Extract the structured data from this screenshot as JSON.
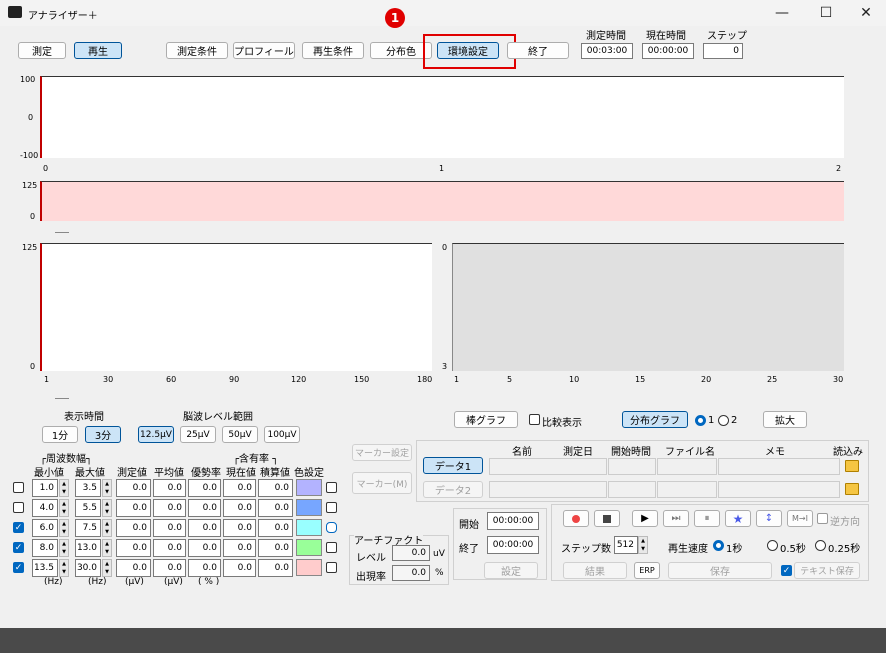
{
  "window": {
    "title": "アナライザー＋",
    "min": "—",
    "max": "☐",
    "close": "✕"
  },
  "toolbar": {
    "measure": "測定",
    "play": "再生",
    "cond": "測定条件",
    "profile": "プロフィール",
    "playcond": "再生条件",
    "distcolor": "分布色",
    "envset": "環境設定",
    "exit": "終了"
  },
  "callout": "1",
  "timers": {
    "meas_label": "測定時間",
    "meas_value": "00:03:00",
    "cur_label": "現在時間",
    "cur_value": "00:00:00",
    "step_label": "ステップ",
    "step_value": "0"
  },
  "plot1": {
    "y": [
      "100",
      "0",
      "-100"
    ],
    "x": [
      "0",
      "1",
      "2"
    ]
  },
  "plot2": {
    "y": [
      "125",
      "0"
    ]
  },
  "plot3": {
    "y": [
      "125",
      "0"
    ],
    "x": [
      "1",
      "30",
      "60",
      "90",
      "120",
      "150",
      "180"
    ]
  },
  "plot4": {
    "y": [
      "0",
      "3"
    ],
    "x": [
      "1",
      "5",
      "10",
      "15",
      "20",
      "25",
      "30"
    ]
  },
  "display": {
    "time_label": "表示時間",
    "t1": "1分",
    "t3": "3分",
    "range_label": "脳波レベル範囲",
    "r1": "12.5μV",
    "r2": "25μV",
    "r3": "50μV",
    "r4": "100μV"
  },
  "freq": {
    "band": "┌周波数幅┐",
    "min": "最小値",
    "max": "最大値",
    "meas": "測定値",
    "avg": "平均値",
    "dom": "優勢率",
    "rate": "┌含有率 ┐",
    "cur": "現在値",
    "acc": "積算値",
    "color": "色設定",
    "rows": [
      {
        "min": "1.0",
        "max": "3.5",
        "meas": "0.0",
        "avg": "0.0",
        "dom": "0.0",
        "cur": "0.0",
        "acc": "0.0",
        "checked": false,
        "color": "#b3b3ff"
      },
      {
        "min": "4.0",
        "max": "5.5",
        "meas": "0.0",
        "avg": "0.0",
        "dom": "0.0",
        "cur": "0.0",
        "acc": "0.0",
        "checked": false,
        "color": "#77a6ff"
      },
      {
        "min": "6.0",
        "max": "7.5",
        "meas": "0.0",
        "avg": "0.0",
        "dom": "0.0",
        "cur": "0.0",
        "acc": "0.0",
        "checked": true,
        "color": "#99ffff"
      },
      {
        "min": "8.0",
        "max": "13.0",
        "meas": "0.0",
        "avg": "0.0",
        "dom": "0.0",
        "cur": "0.0",
        "acc": "0.0",
        "checked": true,
        "color": "#99ff99"
      },
      {
        "min": "13.5",
        "max": "30.0",
        "meas": "0.0",
        "avg": "0.0",
        "dom": "0.0",
        "cur": "0.0",
        "acc": "0.0",
        "checked": true,
        "color": "#ffcccc"
      }
    ],
    "units": [
      "(Hz)",
      "(Hz)",
      "(μV)",
      "(μV)",
      "( % )"
    ]
  },
  "marker": {
    "set": "マーカー設定",
    "m": "マーカー(M)"
  },
  "artifact": {
    "title": "アーチファクト",
    "level": "レベル",
    "level_val": "0.0",
    "level_unit": "uV",
    "rate": "出現率",
    "rate_val": "0.0",
    "rate_unit": "%"
  },
  "graph": {
    "bar": "棒グラフ",
    "compare": "比較表示",
    "dist": "分布グラフ",
    "opt1": "1",
    "opt2": "2",
    "zoom": "拡大"
  },
  "files": {
    "name": "名前",
    "date": "測定日",
    "start": "開始時間",
    "file": "ファイル名",
    "memo": "メモ",
    "load": "読込み",
    "data1": "データ1",
    "data2": "データ2"
  },
  "range": {
    "start": "開始",
    "start_val": "00:00:00",
    "end": "終了",
    "end_val": "00:00:00",
    "set": "設定"
  },
  "playback": {
    "reverse": "逆方向",
    "steps_label": "ステップ数",
    "steps_val": "512",
    "speed": "再生速度",
    "s1": "1秒",
    "s05": "0.5秒",
    "s025": "0.25秒",
    "result": "結果",
    "erp": "ERP",
    "save": "保存",
    "textsave": "テキスト保存"
  }
}
